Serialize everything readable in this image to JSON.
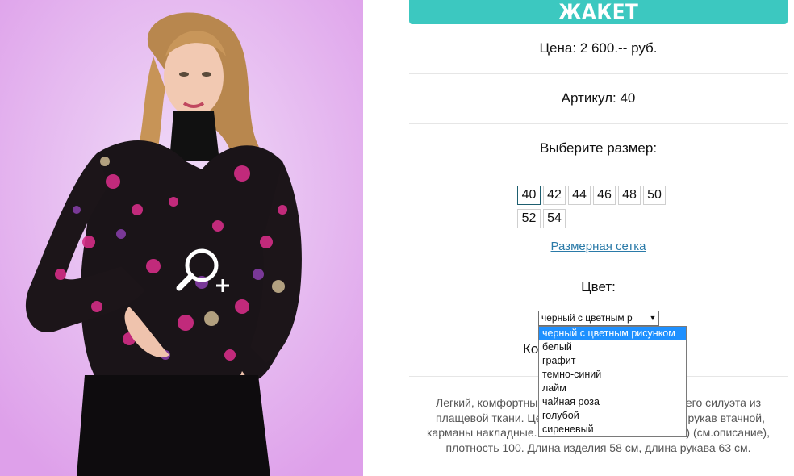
{
  "product": {
    "title": "ЖАКЕТ",
    "price": "Цена: 2 600.-- руб.",
    "article": "Артикул: 40",
    "choose_size": "Выберите размер:",
    "sizes": [
      "40",
      "42",
      "44",
      "46",
      "48",
      "50",
      "52",
      "54"
    ],
    "selected_size": "40",
    "size_chart_link": "Размерная сетка",
    "color_label": "Цвет:",
    "color_select": {
      "value": "черный с цветным р",
      "options": [
        "черный с цветным рисунком",
        "белый",
        "графит",
        "темно-синий",
        "лайм",
        "чайная роза",
        "голубой",
        "сиреневый"
      ],
      "selected_index": 0
    },
    "quantity_label_visible": "Ко",
    "description": {
      "line1_left": "Легкий, комфортный",
      "line1_right": "щего силуэта из",
      "line2_left": "плащевой ткани. Цен",
      "line2_right": "рукав втачной,",
      "line3_left": "карманы накладные. У",
      "line3_right": "е) (см.описание),",
      "line4": "плотность 100. Длина изделия 58 см, длина рукава 63 см."
    }
  },
  "colors": {
    "accent": "#3cc8c0",
    "link": "#2a7aa8",
    "dropdown_highlight": "#1e90ff",
    "photo_background": "#e8c9f3"
  },
  "icons": {
    "zoom": "zoom-in-magnifier-icon",
    "select_arrow": "triangle-down-icon"
  }
}
